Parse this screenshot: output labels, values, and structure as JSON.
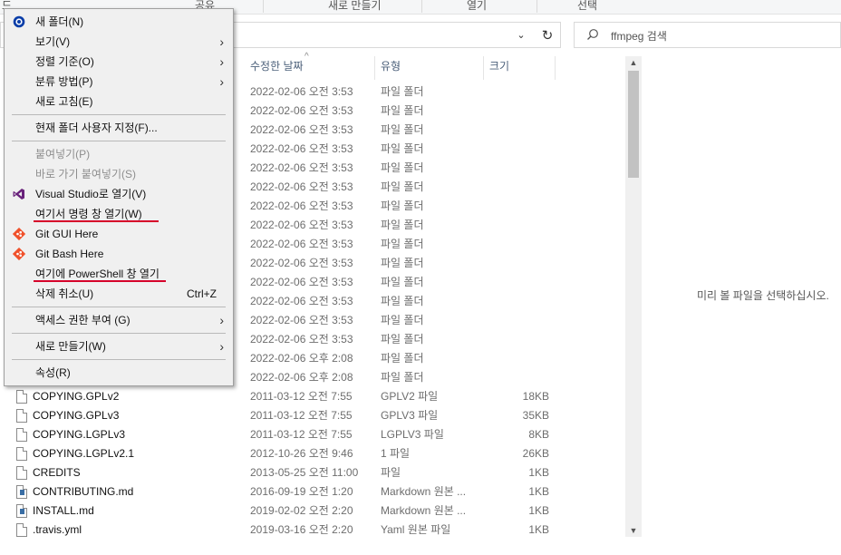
{
  "ribbon": {
    "tabs": [
      "드",
      "공유",
      "새로 만들기",
      "열기",
      "선택"
    ]
  },
  "address": {
    "dropdown_glyph": "⌄",
    "refresh_glyph": "↻"
  },
  "search": {
    "placeholder": "ffmpeg 검색"
  },
  "columns": {
    "date": "수정한 날짜",
    "type": "유형",
    "size": "크기"
  },
  "files": [
    {
      "name": "",
      "date": "2022-02-06 오전 3:53",
      "type": "파일 폴더",
      "size": ""
    },
    {
      "name": "",
      "date": "2022-02-06 오전 3:53",
      "type": "파일 폴더",
      "size": ""
    },
    {
      "name": "",
      "date": "2022-02-06 오전 3:53",
      "type": "파일 폴더",
      "size": ""
    },
    {
      "name": "",
      "date": "2022-02-06 오전 3:53",
      "type": "파일 폴더",
      "size": ""
    },
    {
      "name": "",
      "date": "2022-02-06 오전 3:53",
      "type": "파일 폴더",
      "size": ""
    },
    {
      "name": "",
      "date": "2022-02-06 오전 3:53",
      "type": "파일 폴더",
      "size": ""
    },
    {
      "name": "",
      "date": "2022-02-06 오전 3:53",
      "type": "파일 폴더",
      "size": ""
    },
    {
      "name": "",
      "date": "2022-02-06 오전 3:53",
      "type": "파일 폴더",
      "size": ""
    },
    {
      "name": "",
      "date": "2022-02-06 오전 3:53",
      "type": "파일 폴더",
      "size": ""
    },
    {
      "name": "",
      "date": "2022-02-06 오전 3:53",
      "type": "파일 폴더",
      "size": ""
    },
    {
      "name": "",
      "date": "2022-02-06 오전 3:53",
      "type": "파일 폴더",
      "size": ""
    },
    {
      "name": "",
      "date": "2022-02-06 오전 3:53",
      "type": "파일 폴더",
      "size": ""
    },
    {
      "name": "",
      "date": "2022-02-06 오전 3:53",
      "type": "파일 폴더",
      "size": ""
    },
    {
      "name": "",
      "date": "2022-02-06 오전 3:53",
      "type": "파일 폴더",
      "size": ""
    },
    {
      "name": "",
      "date": "2022-02-06 오후 2:08",
      "type": "파일 폴더",
      "size": ""
    },
    {
      "name": "",
      "date": "2022-02-06 오후 2:08",
      "type": "파일 폴더",
      "size": ""
    },
    {
      "name": "COPYING.GPLv2",
      "date": "2011-03-12 오전 7:55",
      "type": "GPLV2 파일",
      "size": "18KB",
      "icon": "file-icon"
    },
    {
      "name": "COPYING.GPLv3",
      "date": "2011-03-12 오전 7:55",
      "type": "GPLV3 파일",
      "size": "35KB",
      "icon": "file-icon"
    },
    {
      "name": "COPYING.LGPLv3",
      "date": "2011-03-12 오전 7:55",
      "type": "LGPLV3 파일",
      "size": "8KB",
      "icon": "file-icon"
    },
    {
      "name": "COPYING.LGPLv2.1",
      "date": "2012-10-26 오전 9:46",
      "type": "1 파일",
      "size": "26KB",
      "icon": "file-icon"
    },
    {
      "name": "CREDITS",
      "date": "2013-05-25 오전 11:00",
      "type": "파일",
      "size": "1KB",
      "icon": "file-icon"
    },
    {
      "name": "CONTRIBUTING.md",
      "date": "2016-09-19 오전 1:20",
      "type": "Markdown 원본 ...",
      "size": "1KB",
      "icon": "markdown-file-icon"
    },
    {
      "name": "INSTALL.md",
      "date": "2019-02-02 오전 2:20",
      "type": "Markdown 원본 ...",
      "size": "1KB",
      "icon": "markdown-file-icon"
    },
    {
      "name": ".travis.yml",
      "date": "2019-03-16 오전 2:20",
      "type": "Yaml 원본 파일",
      "size": "1KB",
      "icon": "yaml-file-icon"
    }
  ],
  "preview": {
    "message": "미리 볼 파일을 선택하십시오."
  },
  "context_menu": {
    "items": [
      {
        "label": "새 폴더(N)",
        "icon": "new-folder-icon"
      },
      {
        "label": "보기(V)",
        "submenu": true
      },
      {
        "label": "정렬 기준(O)",
        "submenu": true
      },
      {
        "label": "분류 방법(P)",
        "submenu": true
      },
      {
        "label": "새로 고침(E)"
      },
      {
        "label": "현재 폴더 사용자 지정(F)..."
      },
      {
        "label": "붙여넣기(P)",
        "disabled": true
      },
      {
        "label": "바로 가기 붙여넣기(S)",
        "disabled": true
      },
      {
        "label": "Visual Studio로 열기(V)",
        "icon": "visual-studio-icon"
      },
      {
        "label": "여기서 명령 창 열기(W)",
        "highlighted": true
      },
      {
        "label": "Git GUI Here",
        "icon": "git-icon"
      },
      {
        "label": "Git Bash Here",
        "icon": "git-icon"
      },
      {
        "label": "여기에 PowerShell 창 열기",
        "highlighted": true
      },
      {
        "label": "삭제 취소(U)",
        "shortcut": "Ctrl+Z"
      },
      {
        "label": "액세스 권한 부여 (G)",
        "submenu": true
      },
      {
        "label": "새로 만들기(W)",
        "submenu": true
      },
      {
        "label": "속성(R)"
      }
    ],
    "submenu_glyph": "›",
    "highlight_color": "#d6002a"
  },
  "scrollbar": {
    "up_glyph": "▲",
    "down_glyph": "▼"
  },
  "colors": {
    "accent_blue": "#0b3ea8",
    "vs_purple": "#68217a",
    "git_orange": "#f0512b"
  }
}
